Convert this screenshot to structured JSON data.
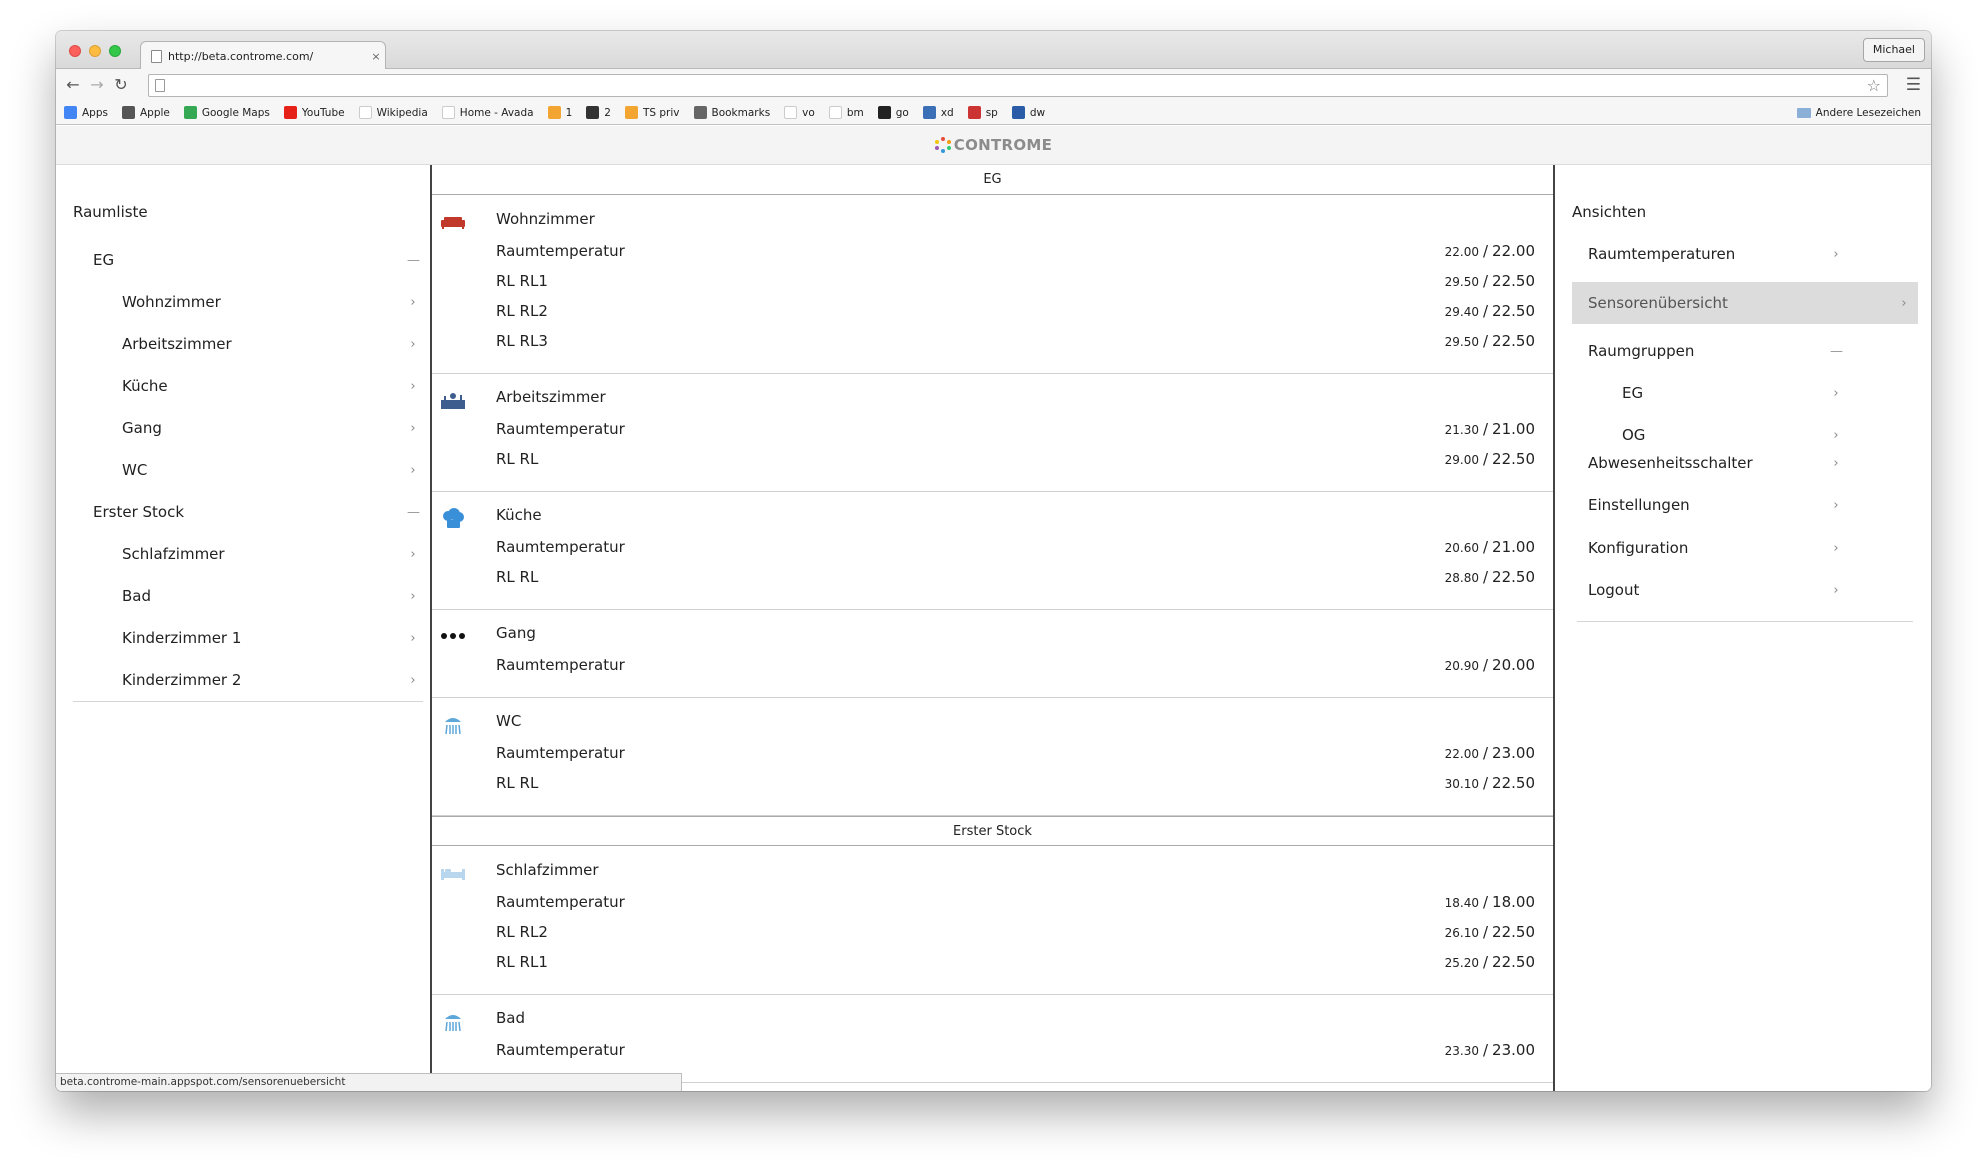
{
  "browser": {
    "tab_title": "http://beta.controme.com/",
    "tab_close": "×",
    "profile": "Michael",
    "url": "",
    "bookmarks": [
      {
        "label": "Apps",
        "icon": "apps-grid-icon",
        "color": "#4285f4"
      },
      {
        "label": "Apple",
        "icon": "apple-icon",
        "color": "#555555"
      },
      {
        "label": "Google Maps",
        "icon": "google-maps-icon",
        "color": "#34a853"
      },
      {
        "label": "YouTube",
        "icon": "youtube-icon",
        "color": "#e62117"
      },
      {
        "label": "Wikipedia",
        "icon": "wikipedia-icon",
        "color": "#ffffff"
      },
      {
        "label": "Home - Avada",
        "icon": "google-g-icon",
        "color": "#ffffff"
      },
      {
        "label": "1",
        "icon": "house-icon",
        "color": "#f2a531"
      },
      {
        "label": "2",
        "icon": "ferris-icon",
        "color": "#333333"
      },
      {
        "label": "TS priv",
        "icon": "house-icon",
        "color": "#f2a531"
      },
      {
        "label": "Bookmarks",
        "icon": "star-icon",
        "color": "#666666"
      },
      {
        "label": "vo",
        "icon": "google-g-icon",
        "color": "#ffffff"
      },
      {
        "label": "bm",
        "icon": "google-g-icon",
        "color": "#ffffff"
      },
      {
        "label": "go",
        "icon": "g-black-icon",
        "color": "#222222"
      },
      {
        "label": "xd",
        "icon": "xd-icon",
        "color": "#3b6fb6"
      },
      {
        "label": "sp",
        "icon": "sp-icon",
        "color": "#cc3333"
      },
      {
        "label": "dw",
        "icon": "dw-icon",
        "color": "#2a5ca8"
      }
    ],
    "other_bookmarks": "Andere Lesezeichen",
    "status_url": "beta.controme-main.appspot.com/sensorenuebersicht"
  },
  "app": {
    "logo_text": "CONTROME"
  },
  "left_nav": {
    "title": "Raumliste",
    "groups": [
      {
        "label": "EG",
        "rooms": [
          "Wohnzimmer",
          "Arbeitszimmer",
          "Küche",
          "Gang",
          "WC"
        ]
      },
      {
        "label": "Erster Stock",
        "rooms": [
          "Schlafzimmer",
          "Bad",
          "Kinderzimmer 1",
          "Kinderzimmer 2"
        ]
      }
    ]
  },
  "right_nav": {
    "title": "Ansichten",
    "items": {
      "raumtemperaturen": "Raumtemperaturen",
      "sensorenuebersicht": "Sensorenübersicht",
      "raumgruppen": "Raumgruppen",
      "eg": "EG",
      "og": "OG",
      "abwesenheitsschalter": "Abwesenheitsschalter",
      "einstellungen": "Einstellungen",
      "konfiguration": "Konfiguration",
      "logout": "Logout"
    }
  },
  "floors": [
    {
      "name": "EG",
      "rooms": [
        {
          "name": "Wohnzimmer",
          "icon": "sofa-icon",
          "icon_color": "#c0392b",
          "sensors": [
            {
              "label": "Raumtemperatur",
              "ist": "22.00",
              "soll": "22.00"
            },
            {
              "label": "RL RL1",
              "ist": "29.50",
              "soll": "22.50"
            },
            {
              "label": "RL RL2",
              "ist": "29.40",
              "soll": "22.50"
            },
            {
              "label": "RL RL3",
              "ist": "29.50",
              "soll": "22.50"
            }
          ]
        },
        {
          "name": "Arbeitszimmer",
          "icon": "desk-icon",
          "icon_color": "#3e5d8f",
          "sensors": [
            {
              "label": "Raumtemperatur",
              "ist": "21.30",
              "soll": "21.00"
            },
            {
              "label": "RL RL",
              "ist": "29.00",
              "soll": "22.50"
            }
          ]
        },
        {
          "name": "Küche",
          "icon": "chef-hat-icon",
          "icon_color": "#3a8fd9",
          "sensors": [
            {
              "label": "Raumtemperatur",
              "ist": "20.60",
              "soll": "21.00"
            },
            {
              "label": "RL RL",
              "ist": "28.80",
              "soll": "22.50"
            }
          ]
        },
        {
          "name": "Gang",
          "icon": "dots-icon",
          "icon_color": "#111111",
          "sensors": [
            {
              "label": "Raumtemperatur",
              "ist": "20.90",
              "soll": "20.00"
            }
          ]
        },
        {
          "name": "WC",
          "icon": "shower-icon",
          "icon_color": "#5da7d9",
          "sensors": [
            {
              "label": "Raumtemperatur",
              "ist": "22.00",
              "soll": "23.00"
            },
            {
              "label": "RL RL",
              "ist": "30.10",
              "soll": "22.50"
            }
          ]
        }
      ]
    },
    {
      "name": "Erster Stock",
      "rooms": [
        {
          "name": "Schlafzimmer",
          "icon": "bed-icon",
          "icon_color": "#b8d6ee",
          "sensors": [
            {
              "label": "Raumtemperatur",
              "ist": "18.40",
              "soll": "18.00"
            },
            {
              "label": "RL RL2",
              "ist": "26.10",
              "soll": "22.50"
            },
            {
              "label": "RL RL1",
              "ist": "25.20",
              "soll": "22.50"
            }
          ]
        },
        {
          "name": "Bad",
          "icon": "shower-icon",
          "icon_color": "#5da7d9",
          "sensors": [
            {
              "label": "Raumtemperatur",
              "ist": "23.30",
              "soll": "23.00"
            }
          ]
        }
      ]
    }
  ],
  "separator": "/",
  "chevron": "›",
  "collapse": "—"
}
